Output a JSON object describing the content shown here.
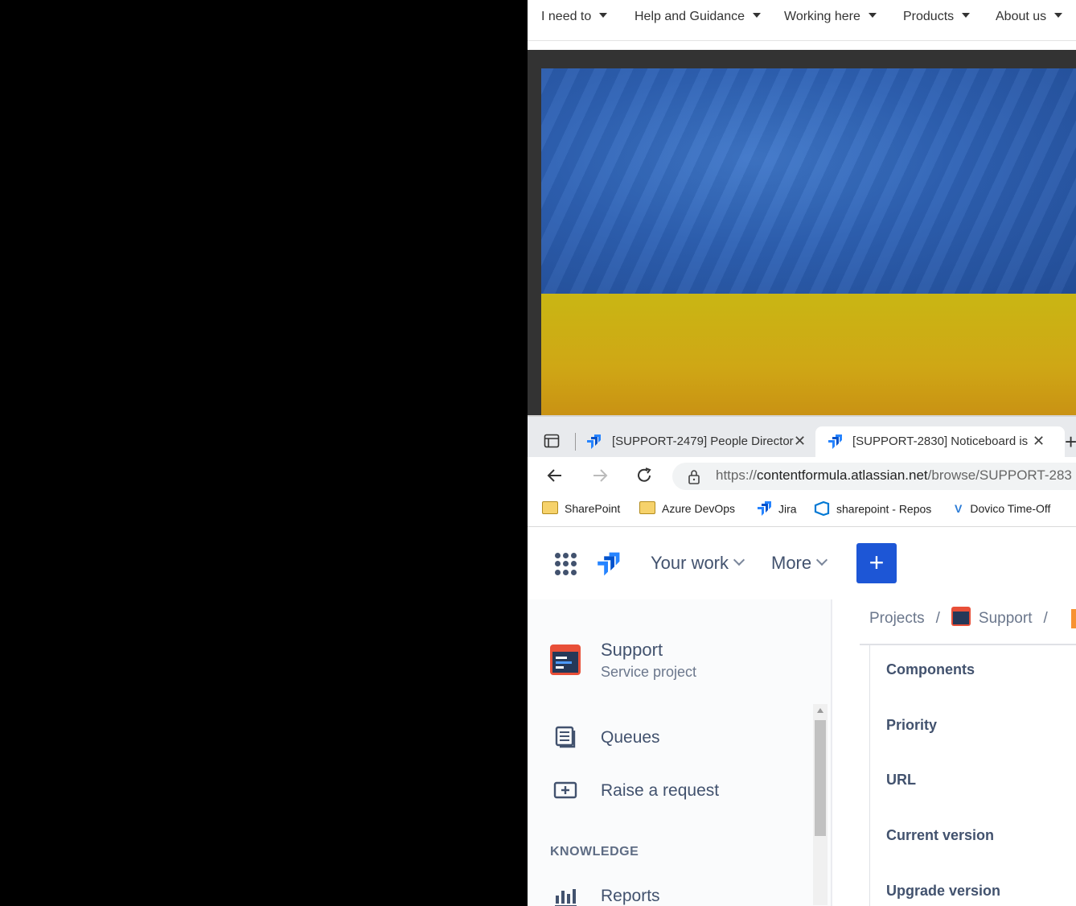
{
  "topnav": {
    "items": [
      {
        "label": "I need to"
      },
      {
        "label": "Help and Guidance"
      },
      {
        "label": "Working here"
      },
      {
        "label": "Products"
      },
      {
        "label": "About us"
      }
    ]
  },
  "browser": {
    "tabs": [
      {
        "title": "[SUPPORT-2479] People Director"
      },
      {
        "title": "[SUPPORT-2830] Noticeboard is"
      }
    ],
    "url_prefix": "https://",
    "url_domain": "contentformula.atlassian.net",
    "url_path": "/browse/SUPPORT-283",
    "bookmarks": [
      {
        "label": "SharePoint"
      },
      {
        "label": "Azure DevOps"
      },
      {
        "label": "Jira"
      },
      {
        "label": "sharepoint - Repos"
      },
      {
        "label": "Dovico Time-Off"
      }
    ]
  },
  "jira": {
    "nav": {
      "your_work": "Your work",
      "more": "More",
      "create": "+"
    },
    "project": {
      "name": "Support",
      "type": "Service project"
    },
    "sidebar": {
      "queues": "Queues",
      "raise": "Raise a request",
      "section": "KNOWLEDGE",
      "reports": "Reports"
    },
    "breadcrumb": {
      "projects": "Projects",
      "sep": "/",
      "support": "Support"
    },
    "fields": [
      "Components",
      "Priority",
      "URL",
      "Current version",
      "Upgrade version"
    ]
  },
  "colors": {
    "jira_blue": "#1d56d6",
    "flag_blue": "#2e62b5",
    "flag_yellow": "#cfa715"
  }
}
